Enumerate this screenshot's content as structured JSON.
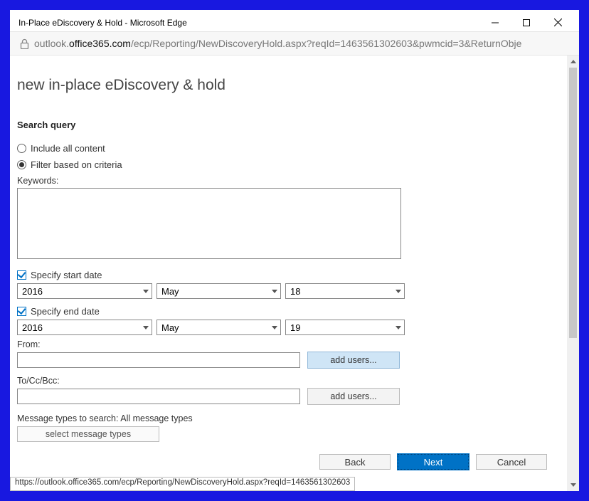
{
  "window": {
    "title": "In-Place eDiscovery & Hold - Microsoft Edge"
  },
  "url": {
    "host_prefix": "outlook.",
    "host_bold": "office365.com",
    "path": "/ecp/Reporting/NewDiscoveryHold.aspx?reqId=1463561302603&pwmcid=3&ReturnObje"
  },
  "page": {
    "title": "new in-place eDiscovery & hold",
    "section": "Search query"
  },
  "options": {
    "include_all": "Include all content",
    "filter": "Filter based on criteria"
  },
  "labels": {
    "keywords": "Keywords:",
    "specify_start": "Specify start date",
    "specify_end": "Specify end date",
    "from": "From:",
    "to": "To/Cc/Bcc:",
    "msg_types_prefix": "Message types to search:",
    "msg_types_value": "All message types"
  },
  "start_date": {
    "year": "2016",
    "month": "May",
    "day": "18"
  },
  "end_date": {
    "year": "2016",
    "month": "May",
    "day": "19"
  },
  "buttons": {
    "add_users": "add users...",
    "select_types": "select message types",
    "back": "Back",
    "next": "Next",
    "cancel": "Cancel"
  },
  "status_url": "https://outlook.office365.com/ecp/Reporting/NewDiscoveryHold.aspx?reqId=1463561302603"
}
